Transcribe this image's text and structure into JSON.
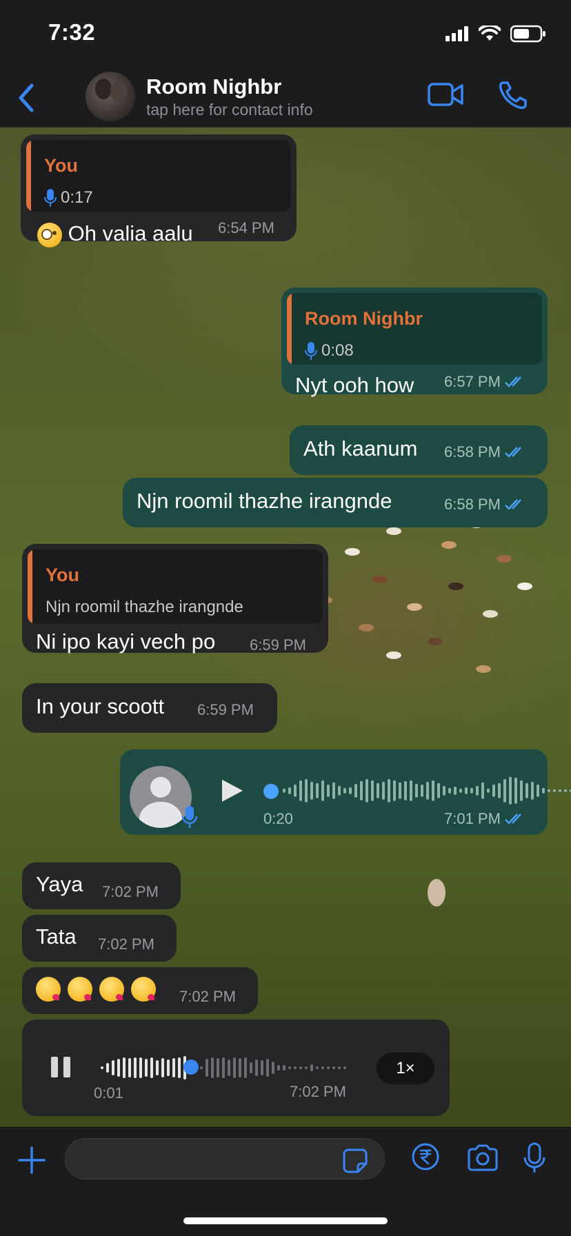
{
  "status_bar": {
    "time": "7:32"
  },
  "header": {
    "contact_name": "Room Nighbr",
    "contact_subtitle": "tap here for contact info"
  },
  "colors": {
    "accent": "#3a86f0",
    "reply_bar": "#e2723c",
    "incoming": "#262628",
    "outgoing": "#1d4a42"
  },
  "messages": [
    {
      "direction": "in",
      "quote_name": "You",
      "quote_text": "0:17",
      "quote_icon": "mic-icon",
      "text": "Oh valia aalu",
      "emoji": "face-with-monocle",
      "time": "6:54 PM"
    },
    {
      "direction": "out",
      "quote_name": "Room Nighbr",
      "quote_text": "0:08",
      "quote_icon": "mic-icon",
      "text": "Nyt ooh how",
      "time": "6:57 PM",
      "read": true
    },
    {
      "direction": "out",
      "text": "Ath kaanum",
      "time": "6:58 PM",
      "read": true
    },
    {
      "direction": "out",
      "text": "Njn roomil thazhe irangnde",
      "time": "6:58 PM",
      "read": true
    },
    {
      "direction": "in",
      "quote_name": "You",
      "quote_text": "Njn roomil thazhe irangnde",
      "text": "Ni ipo kayi vech po",
      "time": "6:59 PM"
    },
    {
      "direction": "in",
      "text": "In your scoott",
      "time": "6:59 PM"
    },
    {
      "direction": "out",
      "type": "voice",
      "duration": "0:20",
      "time": "7:01 PM",
      "read": true,
      "progress": 0
    },
    {
      "direction": "in",
      "text": "Yaya",
      "time": "7:02 PM"
    },
    {
      "direction": "in",
      "text": "Tata",
      "time": "7:02 PM"
    },
    {
      "direction": "in",
      "type": "emoji",
      "emojis": [
        "kissing-face",
        "kissing-face",
        "kissing-face",
        "kissing-face"
      ],
      "time": "7:02 PM"
    },
    {
      "direction": "in",
      "type": "voice",
      "duration": "0:01",
      "time": "7:02 PM",
      "speed": "1×",
      "progress": 0.34
    }
  ],
  "composer": {
    "placeholder": ""
  }
}
